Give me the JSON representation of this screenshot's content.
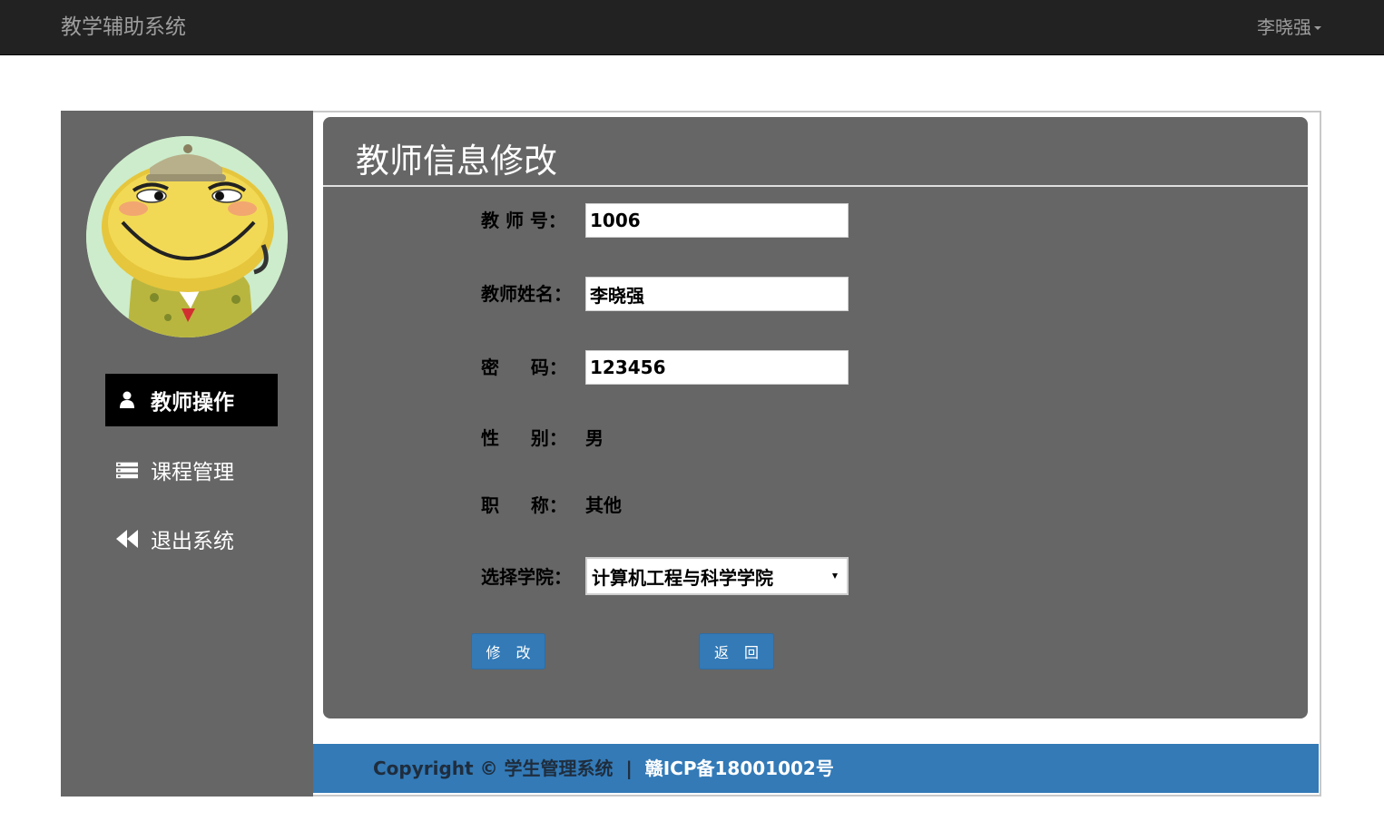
{
  "app": {
    "title": "教学辅助系统",
    "user_name": "李晓强"
  },
  "sidebar": {
    "items": [
      {
        "label": "教师操作",
        "icon": "user-icon",
        "active": true
      },
      {
        "label": "课程管理",
        "icon": "list-icon",
        "active": false
      },
      {
        "label": "退出系统",
        "icon": "backward-icon",
        "active": false
      }
    ]
  },
  "form": {
    "title": "教师信息修改",
    "teacher_id": {
      "label": "教 师 号：",
      "value": "1006"
    },
    "teacher_name": {
      "label": "教师姓名：",
      "value": "李晓强"
    },
    "password": {
      "label": "密     码：",
      "value": "123456"
    },
    "gender": {
      "label": "性     别：",
      "value": "男"
    },
    "title_rank": {
      "label": "职     称：",
      "value": "其他"
    },
    "college": {
      "label": "选择学院：",
      "selected": "计算机工程与科学学院"
    },
    "submit_label": "修 改",
    "back_label": "返 回"
  },
  "footer": {
    "copyright": "Copyright © 学生管理系统",
    "separator": "|",
    "icp": "赣ICP备18001002号"
  },
  "colors": {
    "navbar": "#222222",
    "sidebar": "#666666",
    "active_item": "#000000",
    "button": "#337ab7",
    "footer": "#337ab7"
  }
}
